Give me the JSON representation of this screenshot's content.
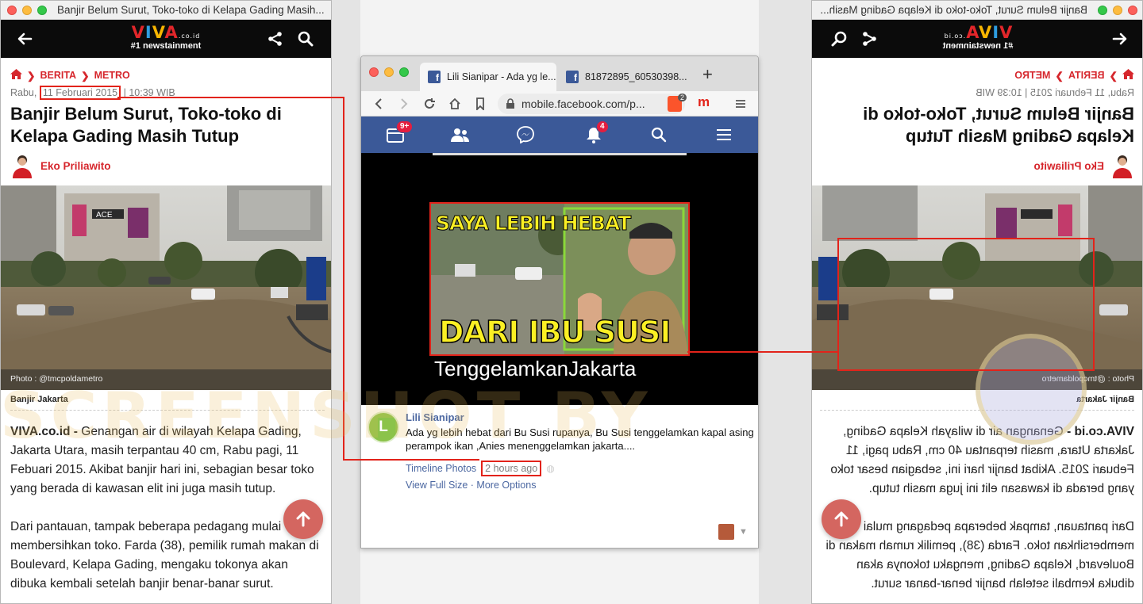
{
  "left_window": {
    "title": "Banjir Belum Surut, Toko-toko di Kelapa Gading Masih...",
    "logo_brand": "VIVA",
    "logo_suffix": ".co.id",
    "logo_tagline": "#1 newstainment",
    "breadcrumb": [
      "BERITA",
      "METRO"
    ],
    "date_prefix": "Rabu,",
    "date_highlight": "11 Februari 2015",
    "date_suffix": "| 10:39 WIB",
    "headline": "Banjir Belum Surut, Toko-toko di Kelapa Gading Masih Tutup",
    "author": "Eko Priliawito",
    "photo_caption": "Photo : @tmcpoldametro",
    "photo_subcaption": "Banjir Jakarta",
    "body_lead": "VIVA.co.id -",
    "body_p1": "Genangan air di wilayah Kelapa Gading, Jakarta Utara, masih terpantau 40 cm, Rabu pagi, 11 Febuari 2015. Akibat banjir hari ini, sebagian besar toko yang berada di kawasan elit ini juga masih tutup.",
    "body_p2": "Dari pantauan, tampak beberapa pedagang mulai membersihkan toko. Farda (38), pemilik rumah makan di Boulevard, Kelapa Gading, mengaku tokonya akan dibuka kembali setelah banjir benar-banar surut."
  },
  "right_window": {
    "title": "Banjir Belum Surut, Toko-toko di Kelapa Gading Masih...",
    "logo_brand": "VIVA",
    "logo_suffix": ".co.id",
    "logo_tagline": "#1 newstainment",
    "breadcrumb": [
      "BERITA",
      "METRO"
    ],
    "date_line": "Rabu, 11 Februari 2015 | 10:39 WIB",
    "headline": "Banjir Belum Surut, Toko-toko di Kelapa Gading Masih Tutup",
    "author": "Eko Priliawito",
    "photo_caption": "Photo : @tmcpoldametro",
    "photo_subcaption": "Banjir Jakarta",
    "body_lead": "VIVA.co.id -",
    "body_p1": "Genangan air di wilayah Kelapa Gading, Jakarta Utara, masih terpantau 40 cm, Rabu pagi, 11 Febuari 2015. Akibat banjir hari ini, sebagian besar toko yang berada di kawasan elit ini juga masih tutup.",
    "body_p2": "Dari pantauan, tampak beberapa pedagang mulai membersihkan toko. Farda (38), pemilik rumah makan di Boulevard, Kelapa Gading, mengaku tokonya akan dibuka kembali setelah banjir benar-banar surut."
  },
  "facebook_window": {
    "tabs": [
      {
        "label": "Lili Sianipar - Ada yg le..."
      },
      {
        "label": "81872895_60530398..."
      }
    ],
    "new_tab": "+",
    "url": "mobile.facebook.com/p...",
    "brave_badge": "2",
    "ext_letter": "m",
    "nav_badges": {
      "home": "9+",
      "notifications": "4"
    },
    "meme_top_text": "SAYA LEBIH HEBAT",
    "meme_bottom_text": "DARI IBU SUSI",
    "meme_hashtag": "TenggelamkanJakarta",
    "post_avatar_letter": "L",
    "post_author": "Lili Sianipar",
    "post_text": "Ada yg lebih hebat dari Bu Susi rupanya, Bu Susi tenggelamkan kapal asing perampok ikan ,Anies menenggelamkan jakarta....",
    "post_link_album": "Timeline Photos",
    "post_time": "2 hours ago",
    "post_link_full": "View Full Size",
    "post_link_sep": "·",
    "post_link_options": "More Options"
  },
  "watermark": "SCREENSHOT BY",
  "colors": {
    "viva_red": "#d6262c",
    "facebook_blue": "#3b5998",
    "annotation_red": "#e2231a",
    "scroll_top_button": "#d46660"
  }
}
